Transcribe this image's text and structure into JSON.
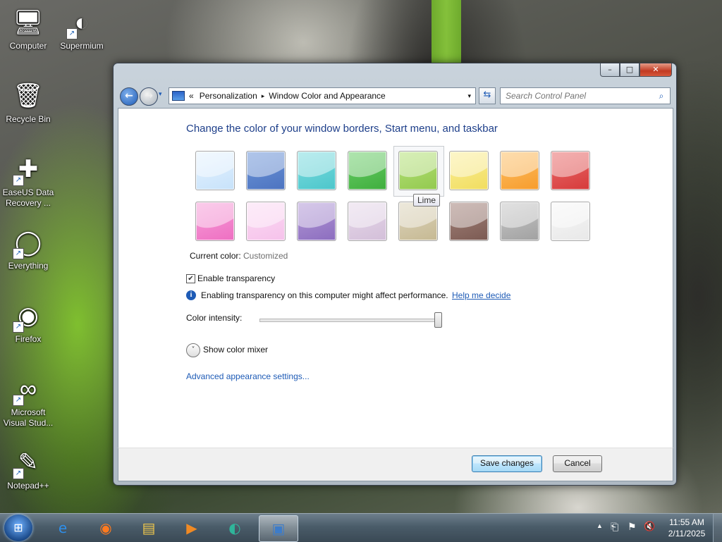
{
  "desktop": {
    "icons": [
      {
        "label": "Computer",
        "symbol": "🖥",
        "shortcut": false
      },
      {
        "label": "Supermium",
        "symbol": "◐",
        "shortcut": true
      },
      {
        "label": "Recycle Bin",
        "symbol": "🗑",
        "shortcut": false
      },
      {
        "label": "EaseUS Data Recovery ...",
        "symbol": "✚",
        "shortcut": true
      },
      {
        "label": "Everything",
        "symbol": "◯",
        "shortcut": true
      },
      {
        "label": "Firefox",
        "symbol": "◉",
        "shortcut": true
      },
      {
        "label": "Microsoft Visual Stud...",
        "symbol": "∞",
        "shortcut": true
      },
      {
        "label": "Notepad++",
        "symbol": "✎",
        "shortcut": true
      }
    ]
  },
  "window": {
    "controls": {
      "minimize": "–",
      "maximize": "□",
      "close": "✕"
    },
    "nav": {
      "back": "←",
      "forward": "→",
      "history_dropdown": "▾"
    },
    "address": {
      "overflow": "«",
      "crumbs": [
        "Personalization",
        "Window Color and Appearance"
      ],
      "separator": "▸",
      "dropdown": "▾"
    },
    "refresh_symbol": "⇆",
    "search": {
      "placeholder": "Search Control Panel",
      "icon": "⌕"
    }
  },
  "main": {
    "title": "Change the color of your window borders, Start menu, and taskbar",
    "swatches": [
      {
        "color": "#e6f3ff",
        "shade": "#c7e2fa"
      },
      {
        "color": "#6f97d9",
        "shade": "#4c73c0"
      },
      {
        "color": "#7fdde0",
        "shade": "#4cc6cb"
      },
      {
        "color": "#6ccf6a",
        "shade": "#3fae3d"
      },
      {
        "color": "#b6e27a",
        "shade": "#93c94f"
      },
      {
        "color": "#fbef9a",
        "shade": "#f1dd5f"
      },
      {
        "color": "#fdc168",
        "shade": "#f79c2c"
      },
      {
        "color": "#ea6f6f",
        "shade": "#d63a3a"
      },
      {
        "color": "#f7a0d9",
        "shade": "#ee6fc2"
      },
      {
        "color": "#fbdcf3",
        "shade": "#f6c2eb"
      },
      {
        "color": "#b39ad6",
        "shade": "#8c6dbf"
      },
      {
        "color": "#e7d9ea",
        "shade": "#d3bfd9"
      },
      {
        "color": "#ddd5bd",
        "shade": "#c6b993"
      },
      {
        "color": "#a5847c",
        "shade": "#7b5a52"
      },
      {
        "color": "#c8c8c8",
        "shade": "#a1a1a1"
      },
      {
        "color": "#f7f7f7",
        "shade": "#e8e8e8"
      }
    ],
    "tooltip": "Lime",
    "current_color_label": "Current color:",
    "current_color_value": "Customized",
    "transparency_label": "Enable transparency",
    "transparency_checked": true,
    "transparency_check": "✔",
    "info_symbol": "i",
    "info_text": "Enabling transparency on this computer might affect performance.",
    "help_link": "Help me decide",
    "intensity_label": "Color intensity:",
    "intensity_value": 1.0,
    "mixer_symbol": "˅",
    "mixer_label": "Show color mixer",
    "advanced_link": "Advanced appearance settings..."
  },
  "footer": {
    "save": "Save changes",
    "cancel": "Cancel"
  },
  "taskbar": {
    "start_symbol": "⊞",
    "items": [
      {
        "name": "internet-explorer",
        "symbol": "e",
        "color": "#2f8ee8"
      },
      {
        "name": "firefox",
        "symbol": "◉",
        "color": "#ff7a1f"
      },
      {
        "name": "file-explorer",
        "symbol": "▤",
        "color": "#f2c94c"
      },
      {
        "name": "media-player",
        "symbol": "▶",
        "color": "#f08a24"
      },
      {
        "name": "supermium",
        "symbol": "◐",
        "color": "#2fb59a"
      },
      {
        "name": "control-panel",
        "symbol": "▣",
        "color": "#3d7cc9"
      }
    ],
    "tray": {
      "expand": "▲",
      "network": "⎗",
      "flag": "⚑",
      "volume": "🔇"
    },
    "time": "11:55 AM",
    "date": "2/11/2025"
  },
  "colors": {
    "accent": "#1e5bb6",
    "title_text": "#1e3f8a",
    "muted_text": "#6d6d6d"
  }
}
